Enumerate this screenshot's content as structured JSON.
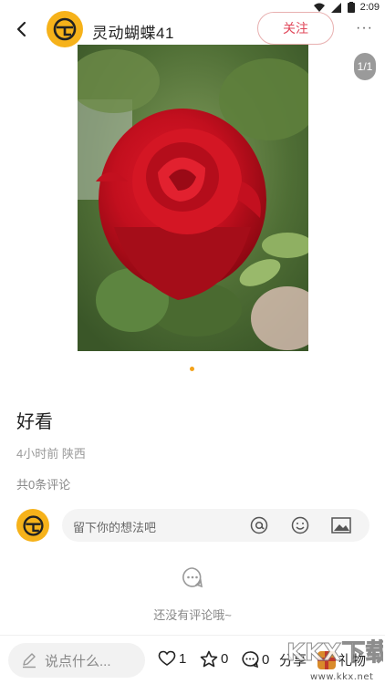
{
  "status_bar": {
    "time": "2:09"
  },
  "header": {
    "username": "灵动蝴蝶41",
    "follow_label": "关注",
    "more_label": "···"
  },
  "photo": {
    "description_icon": "rose-photo",
    "page_indicator": "1/1"
  },
  "post": {
    "title": "好看",
    "meta": "4小时前 陕西",
    "comment_count": "共0条评论"
  },
  "comment_input": {
    "placeholder": "留下你的想法吧"
  },
  "empty_state": {
    "text": "还没有评论哦~"
  },
  "bottom_bar": {
    "say_placeholder": "说点什么...",
    "likes": "1",
    "stars": "0",
    "comments": "0",
    "share_label": "分享",
    "gift_label": "礼物"
  },
  "watermark": {
    "logo_text": "KKX下载",
    "url": "www.kkx.net"
  },
  "colors": {
    "avatar": "#f6b21a",
    "follow": "#e0475a",
    "dot_active": "#f3a21a"
  }
}
